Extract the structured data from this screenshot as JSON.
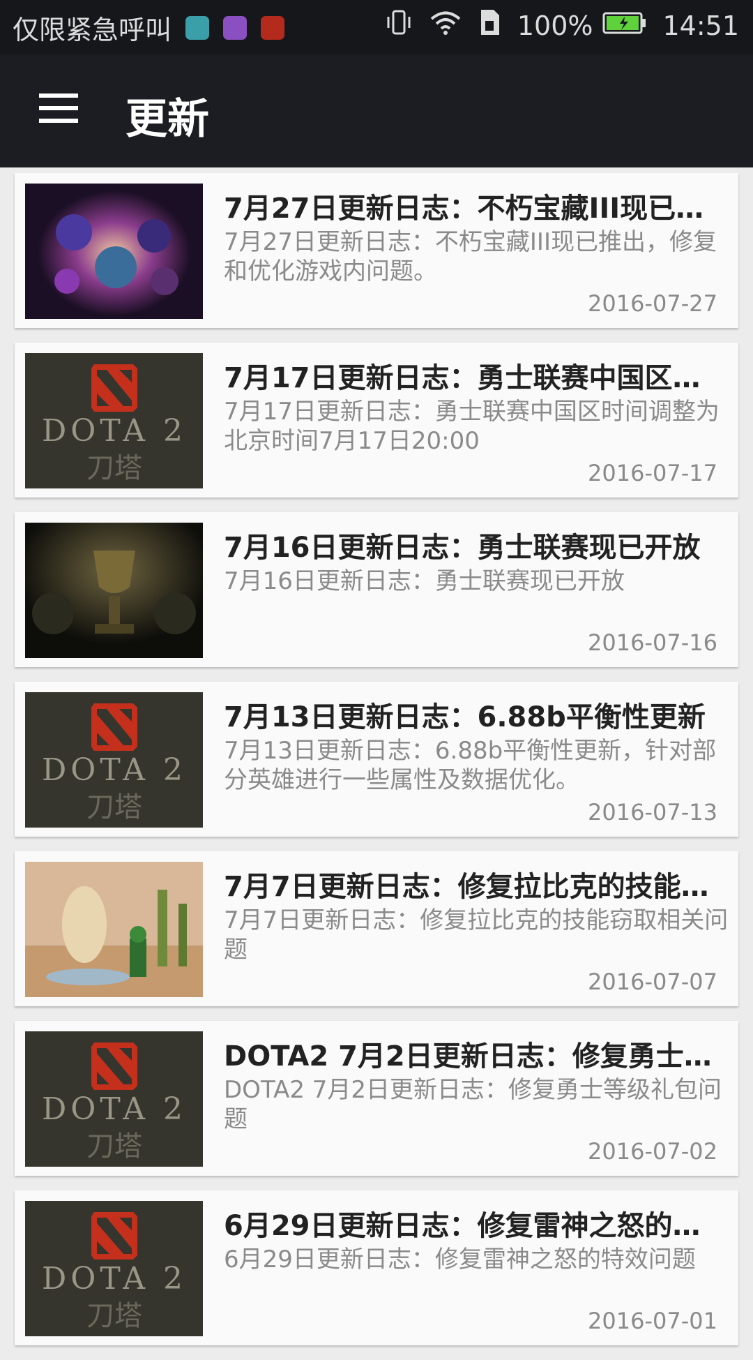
{
  "status_bar": {
    "carrier": "仅限紧急呼叫",
    "battery": "100%",
    "time": "14:51"
  },
  "appbar": {
    "title": "更新"
  },
  "items": [
    {
      "thumb": "crystal-heroes",
      "title": "7月27日更新日志：不朽宝藏III现已推出，修复和优化游戏内问题。",
      "desc": "7月27日更新日志：不朽宝藏III现已推出，修复和优化游戏内问题。",
      "date": "2016-07-27"
    },
    {
      "thumb": "dota2-logo",
      "title": "7月17日更新日志：勇士联赛中国区时间调整为北京时间7月17日20:00",
      "desc": "7月17日更新日志：勇士联赛中国区时间调整为北京时间7月17日20:00",
      "date": "2016-07-17"
    },
    {
      "thumb": "trophy",
      "title": "7月16日更新日志：勇士联赛现已开放",
      "desc": "7月16日更新日志：勇士联赛现已开放",
      "date": "2016-07-16"
    },
    {
      "thumb": "dota2-logo",
      "title": "7月13日更新日志：6.88b平衡性更新",
      "desc": "7月13日更新日志：6.88b平衡性更新，针对部分英雄进行一些属性及数据优化。",
      "date": "2016-07-13"
    },
    {
      "thumb": "desert-scene",
      "title": "7月7日更新日志：修复拉比克的技能窃取相关问题",
      "desc": "7月7日更新日志：修复拉比克的技能窃取相关问题",
      "date": "2016-07-07"
    },
    {
      "thumb": "dota2-logo",
      "title": "DOTA2 7月2日更新日志：修复勇士等级礼包问题",
      "desc": "DOTA2 7月2日更新日志：修复勇士等级礼包问题",
      "date": "2016-07-02"
    },
    {
      "thumb": "dota2-logo",
      "title": "6月29日更新日志：修复雷神之怒的特效问题",
      "desc": "6月29日更新日志：修复雷神之怒的特效问题",
      "date": "2016-07-01"
    }
  ],
  "logo_text": {
    "main": "DOTA 2",
    "sub": "刀塔"
  },
  "colors": {
    "appbar": "#1c1d22",
    "status_bar": "#16171b",
    "card": "#fafafa",
    "background": "#ececec",
    "dota_red": "#c4301c",
    "battery_green": "#5fd13a"
  }
}
